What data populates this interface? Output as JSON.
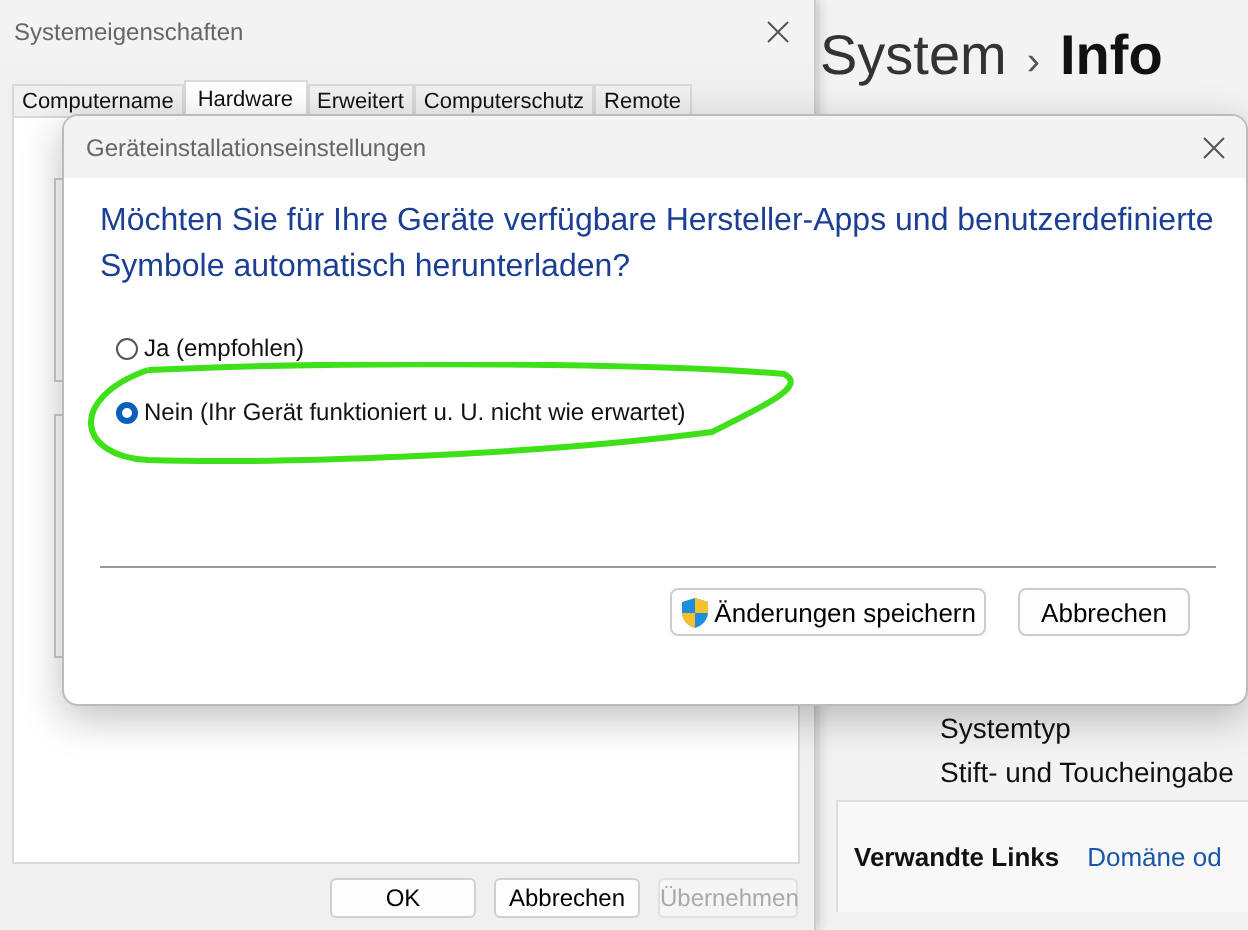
{
  "background_window": {
    "title": "Systemeigenschaften",
    "tabs": [
      {
        "label": "Computername",
        "selected": false
      },
      {
        "label": "Hardware",
        "selected": true
      },
      {
        "label": "Erweitert",
        "selected": false
      },
      {
        "label": "Computerschutz",
        "selected": false
      },
      {
        "label": "Remote",
        "selected": false
      }
    ],
    "buttons": [
      {
        "label": "OK",
        "disabled": false
      },
      {
        "label": "Abbrechen",
        "disabled": false
      },
      {
        "label": "Übernehmen",
        "disabled": true
      }
    ]
  },
  "settings": {
    "breadcrumb_parent": "System",
    "separator": "›",
    "page": "Info",
    "rows": [
      "Systemtyp",
      "Stift- und Toucheingabe"
    ],
    "related_links_label": "Verwandte Links",
    "link": "Domäne od"
  },
  "dialog": {
    "title": "Geräteinstallationseinstellungen",
    "question": "Möchten Sie für Ihre Geräte verfügbare Hersteller-Apps und benutzerdefinierte Symbole automatisch herunterladen?",
    "options": [
      {
        "label": "Ja (empfohlen)",
        "selected": false,
        "highlighted": false
      },
      {
        "label": "Nein (Ihr Gerät funktioniert u. U. nicht wie erwartet)",
        "selected": true,
        "highlighted": true
      }
    ],
    "buttons": [
      {
        "label": "Änderungen speichern",
        "kind": "shield"
      },
      {
        "label": "Abbrechen",
        "kind": "plain"
      }
    ]
  }
}
